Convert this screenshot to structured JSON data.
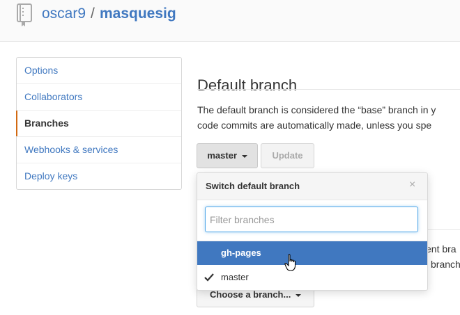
{
  "header": {
    "owner": "oscar9",
    "separator": "/",
    "repo": "masquesig",
    "icon": "repo-book-icon"
  },
  "sidebar": {
    "items": [
      {
        "label": "Options",
        "selected": false
      },
      {
        "label": "Collaborators",
        "selected": false
      },
      {
        "label": "Branches",
        "selected": true
      },
      {
        "label": "Webhooks & services",
        "selected": false
      },
      {
        "label": "Deploy keys",
        "selected": false
      }
    ]
  },
  "main": {
    "title": "Default branch",
    "description_line1": "The default branch is considered the “base” branch in y",
    "description_line2": "code commits are automatically made, unless you spe",
    "branch_button": "master",
    "update_button": "Update",
    "behind_line1": "ent bra",
    "behind_line2": "l branch",
    "choose_button": "Choose a branch..."
  },
  "dropdown": {
    "title": "Switch default branch",
    "close": "×",
    "filter_placeholder": "Filter branches",
    "filter_value": "",
    "items": [
      {
        "label": "gh-pages",
        "highlighted": true,
        "checked": false
      },
      {
        "label": "master",
        "highlighted": false,
        "checked": true
      }
    ]
  },
  "colors": {
    "link": "#4078c0",
    "highlight": "#4078c0",
    "selected_marker": "#d26911"
  }
}
